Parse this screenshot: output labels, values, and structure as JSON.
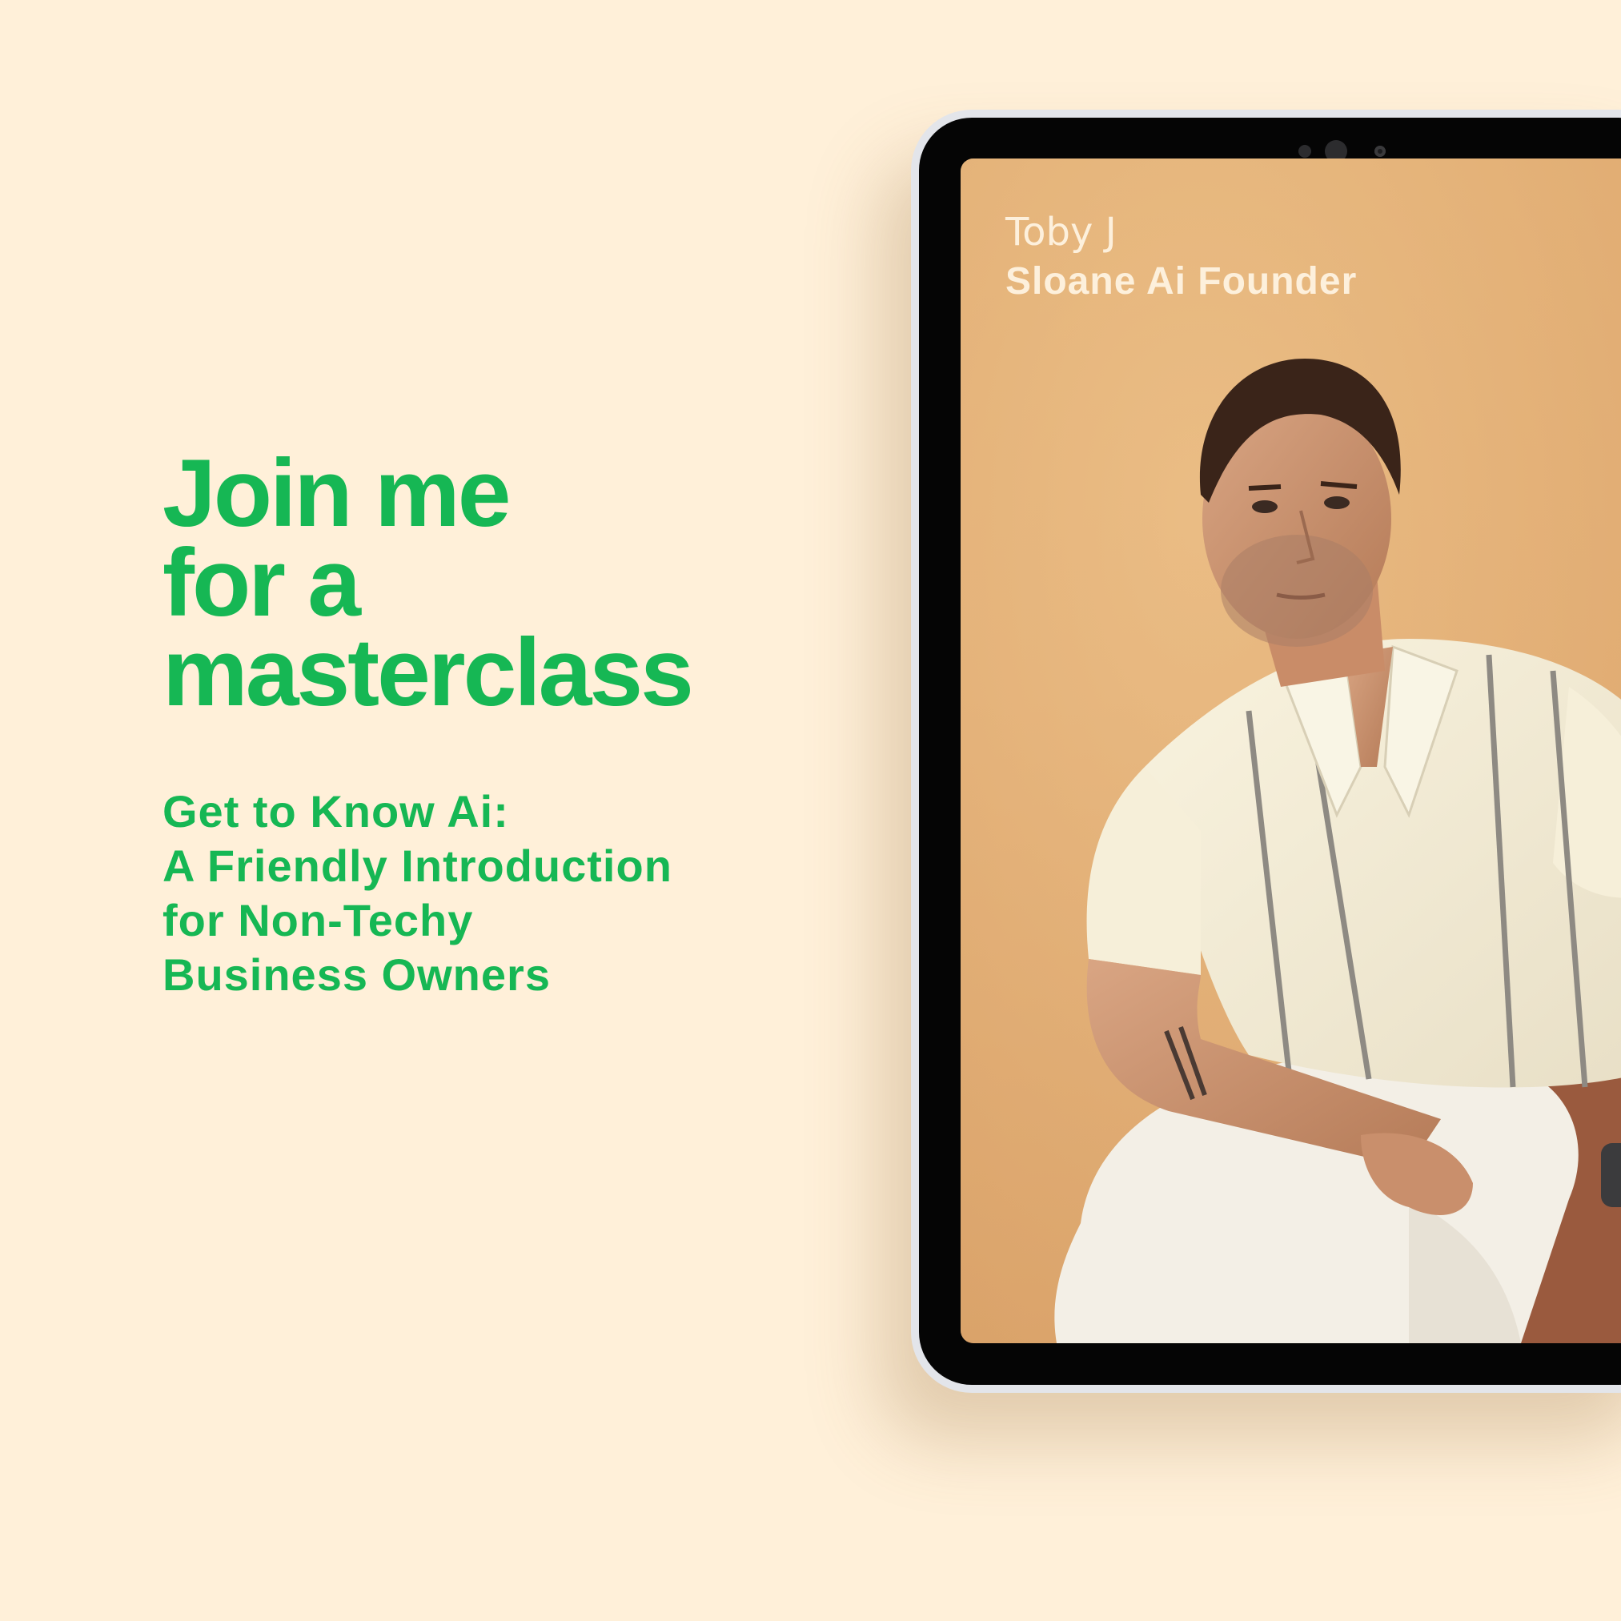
{
  "headline": {
    "line1": "Join me",
    "line2": "for a",
    "line3": "masterclass"
  },
  "subtitle": {
    "line1": "Get to Know Ai:",
    "line2": "A Friendly Introduction",
    "line3": "for Non-Techy",
    "line4": "Business Owners"
  },
  "speaker": {
    "name": "Toby J",
    "title": "Sloane Ai Founder"
  },
  "colors": {
    "background": "#fff0d9",
    "accent_green": "#16b754",
    "overlay_text": "#fdf0dc"
  }
}
